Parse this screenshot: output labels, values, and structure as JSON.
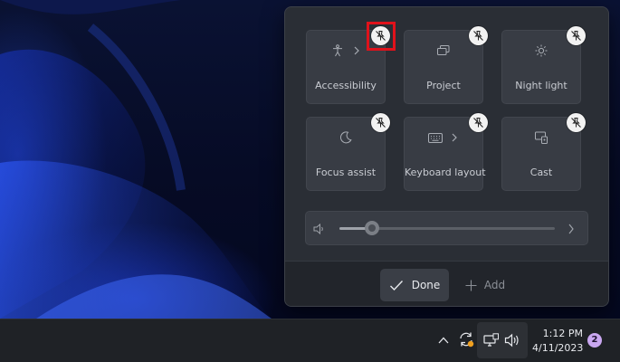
{
  "quick_settings": {
    "tiles": [
      {
        "label": "Accessibility",
        "icon": "accessibility-icon",
        "has_chevron": true
      },
      {
        "label": "Project",
        "icon": "project-icon",
        "has_chevron": false
      },
      {
        "label": "Night light",
        "icon": "night-light-icon",
        "has_chevron": false
      },
      {
        "label": "Focus assist",
        "icon": "focus-assist-icon",
        "has_chevron": false
      },
      {
        "label": "Keyboard layout",
        "icon": "keyboard-icon",
        "has_chevron": true
      },
      {
        "label": "Cast",
        "icon": "cast-icon",
        "has_chevron": false
      }
    ],
    "unpin_icon": "unpin-icon",
    "highlight_color": "#e0121b",
    "volume": {
      "level": 0.15,
      "icon": "speaker-icon"
    },
    "footer": {
      "done_label": "Done",
      "add_label": "Add"
    }
  },
  "taskbar": {
    "tray_icons": [
      "chevron-up-icon",
      "sync-icon",
      "network-icon",
      "volume-icon"
    ],
    "time": "1:12 PM",
    "date": "4/11/2023",
    "notification_count": "2",
    "badge_color": "#c9a7f0"
  },
  "colors": {
    "panel_bg": "#2a2e35",
    "tile_bg": "#383c44",
    "taskbar_bg": "#1f2226",
    "sync_badge": "#f0a020"
  }
}
